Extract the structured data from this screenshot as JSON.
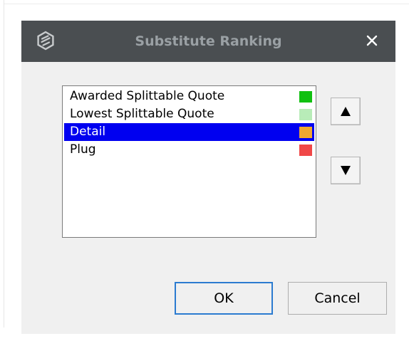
{
  "dialog": {
    "title": "Substitute Ranking",
    "icons": {
      "app": "logo-icon",
      "close": "close-icon"
    }
  },
  "ranking_list": {
    "items": [
      {
        "label": "Awarded Splittable Quote",
        "color": "#10c010",
        "selected": false
      },
      {
        "label": "Lowest Splittable Quote",
        "color": "#b8ecb8",
        "selected": false
      },
      {
        "label": "Detail",
        "color": "#f0a830",
        "selected": true
      },
      {
        "label": "Plug",
        "color": "#f04848",
        "selected": false
      }
    ]
  },
  "controls": {
    "move_up_icon": "triangle-up-icon",
    "move_down_icon": "triangle-down-icon"
  },
  "buttons": {
    "ok_label": "OK",
    "cancel_label": "Cancel"
  },
  "colors": {
    "titlebar": "#4a4e51",
    "selection": "#0000f0",
    "default_button_border": "#2b7bd0"
  }
}
